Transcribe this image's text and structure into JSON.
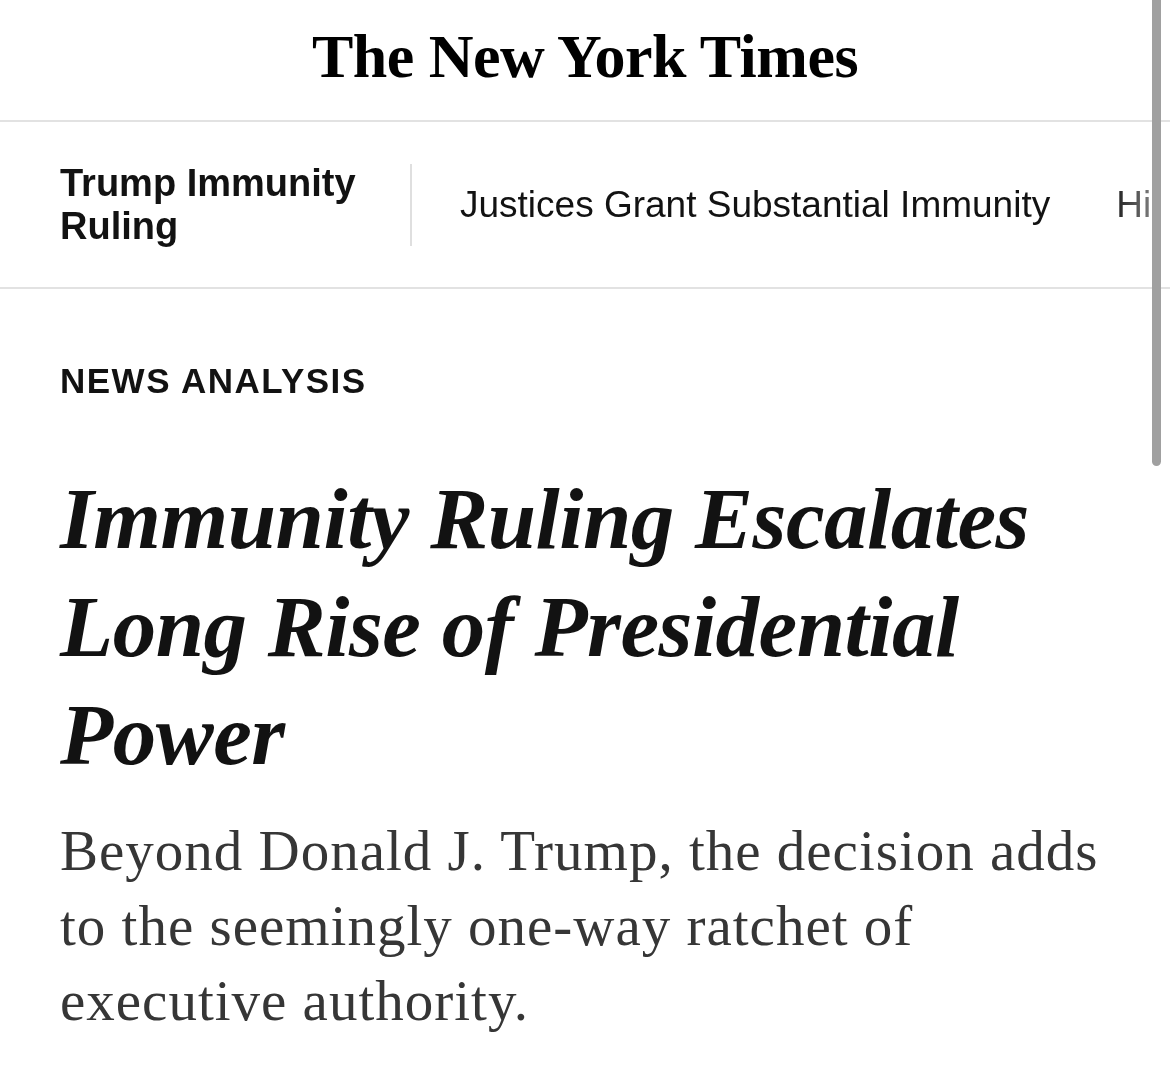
{
  "masthead": {
    "title": "The New York Times"
  },
  "nav": {
    "title": "Trump Immunity Ruling",
    "links": [
      {
        "label": "Justices Grant Substantial Immunity"
      },
      {
        "label": "Hi"
      }
    ]
  },
  "article": {
    "kicker": "NEWS ANALYSIS",
    "headline": "Immunity Ruling Escalates Long Rise of Presidential Power",
    "summary": "Beyond Donald J. Trump, the decision adds to the seemingly one-way ratchet of executive authority."
  }
}
